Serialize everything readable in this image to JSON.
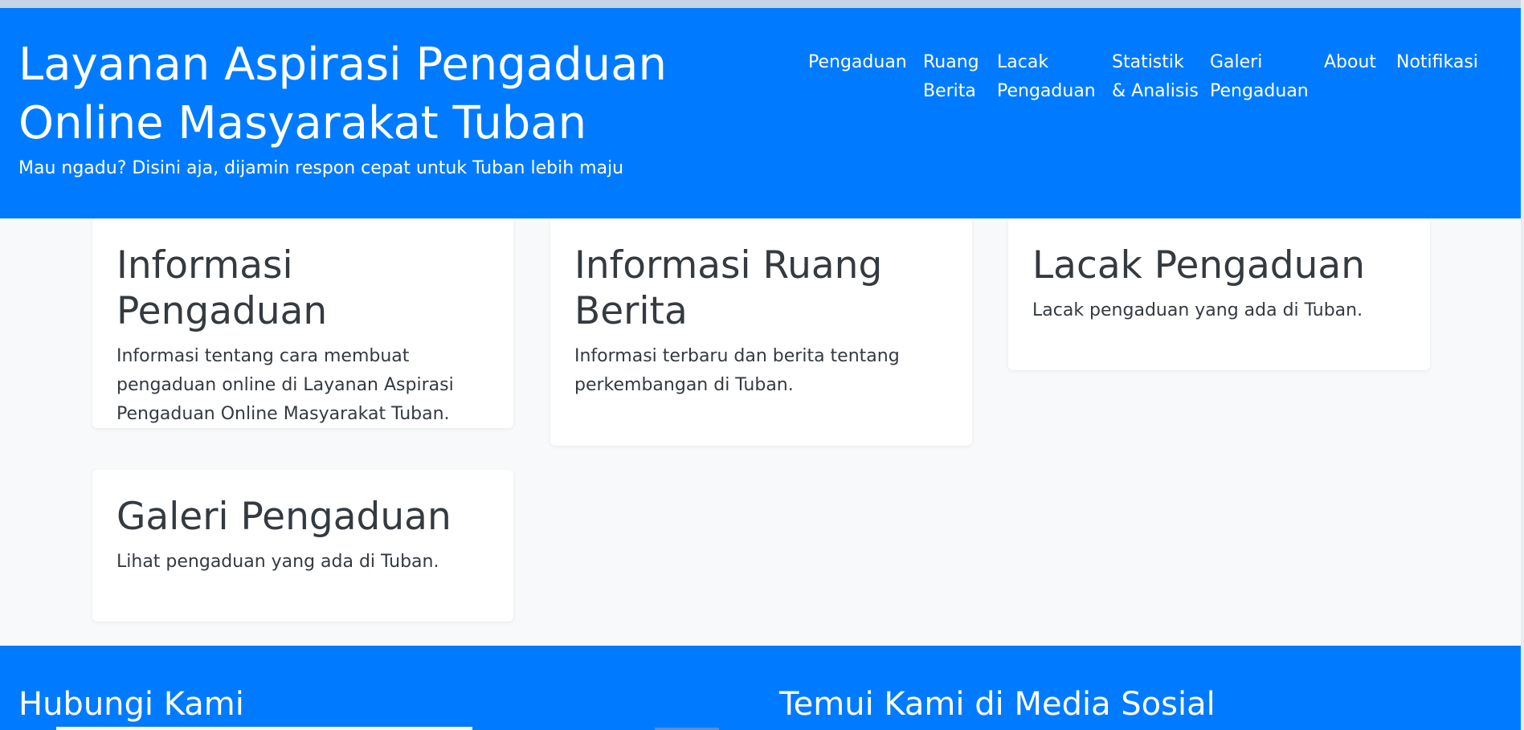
{
  "header": {
    "title": "Layanan Aspirasi Pengaduan Online Masyarakat Tuban",
    "subtitle": "Mau ngadu? Disini aja, dijamin respon cepat untuk Tuban lebih maju"
  },
  "nav": {
    "items": [
      {
        "label": "Pengaduan"
      },
      {
        "label": "Ruang Berita"
      },
      {
        "label": "Lacak Pengaduan"
      },
      {
        "label": "Statistik & Analisis"
      },
      {
        "label": "Galeri Pengaduan"
      },
      {
        "label": "About"
      },
      {
        "label": "Notifikasi"
      }
    ]
  },
  "cards": [
    {
      "title": "Informasi Pengaduan",
      "text": "Informasi tentang cara membuat pengaduan online di Layanan Aspirasi Pengaduan Online Masyarakat Tuban."
    },
    {
      "title": "Informasi Ruang Berita",
      "text": "Informasi terbaru dan berita tentang perkembangan di Tuban."
    },
    {
      "title": "Lacak Pengaduan",
      "text": "Lacak pengaduan yang ada di Tuban."
    },
    {
      "title": "Galeri Pengaduan",
      "text": "Lihat pengaduan yang ada di Tuban."
    }
  ],
  "footer": {
    "contact_title": "Hubungi Kami",
    "social_title": "Temui Kami di Media Sosial"
  },
  "colors": {
    "primary": "#007bff",
    "background": "#f8f9fa",
    "card": "#ffffff",
    "text_dark": "#343a40"
  }
}
